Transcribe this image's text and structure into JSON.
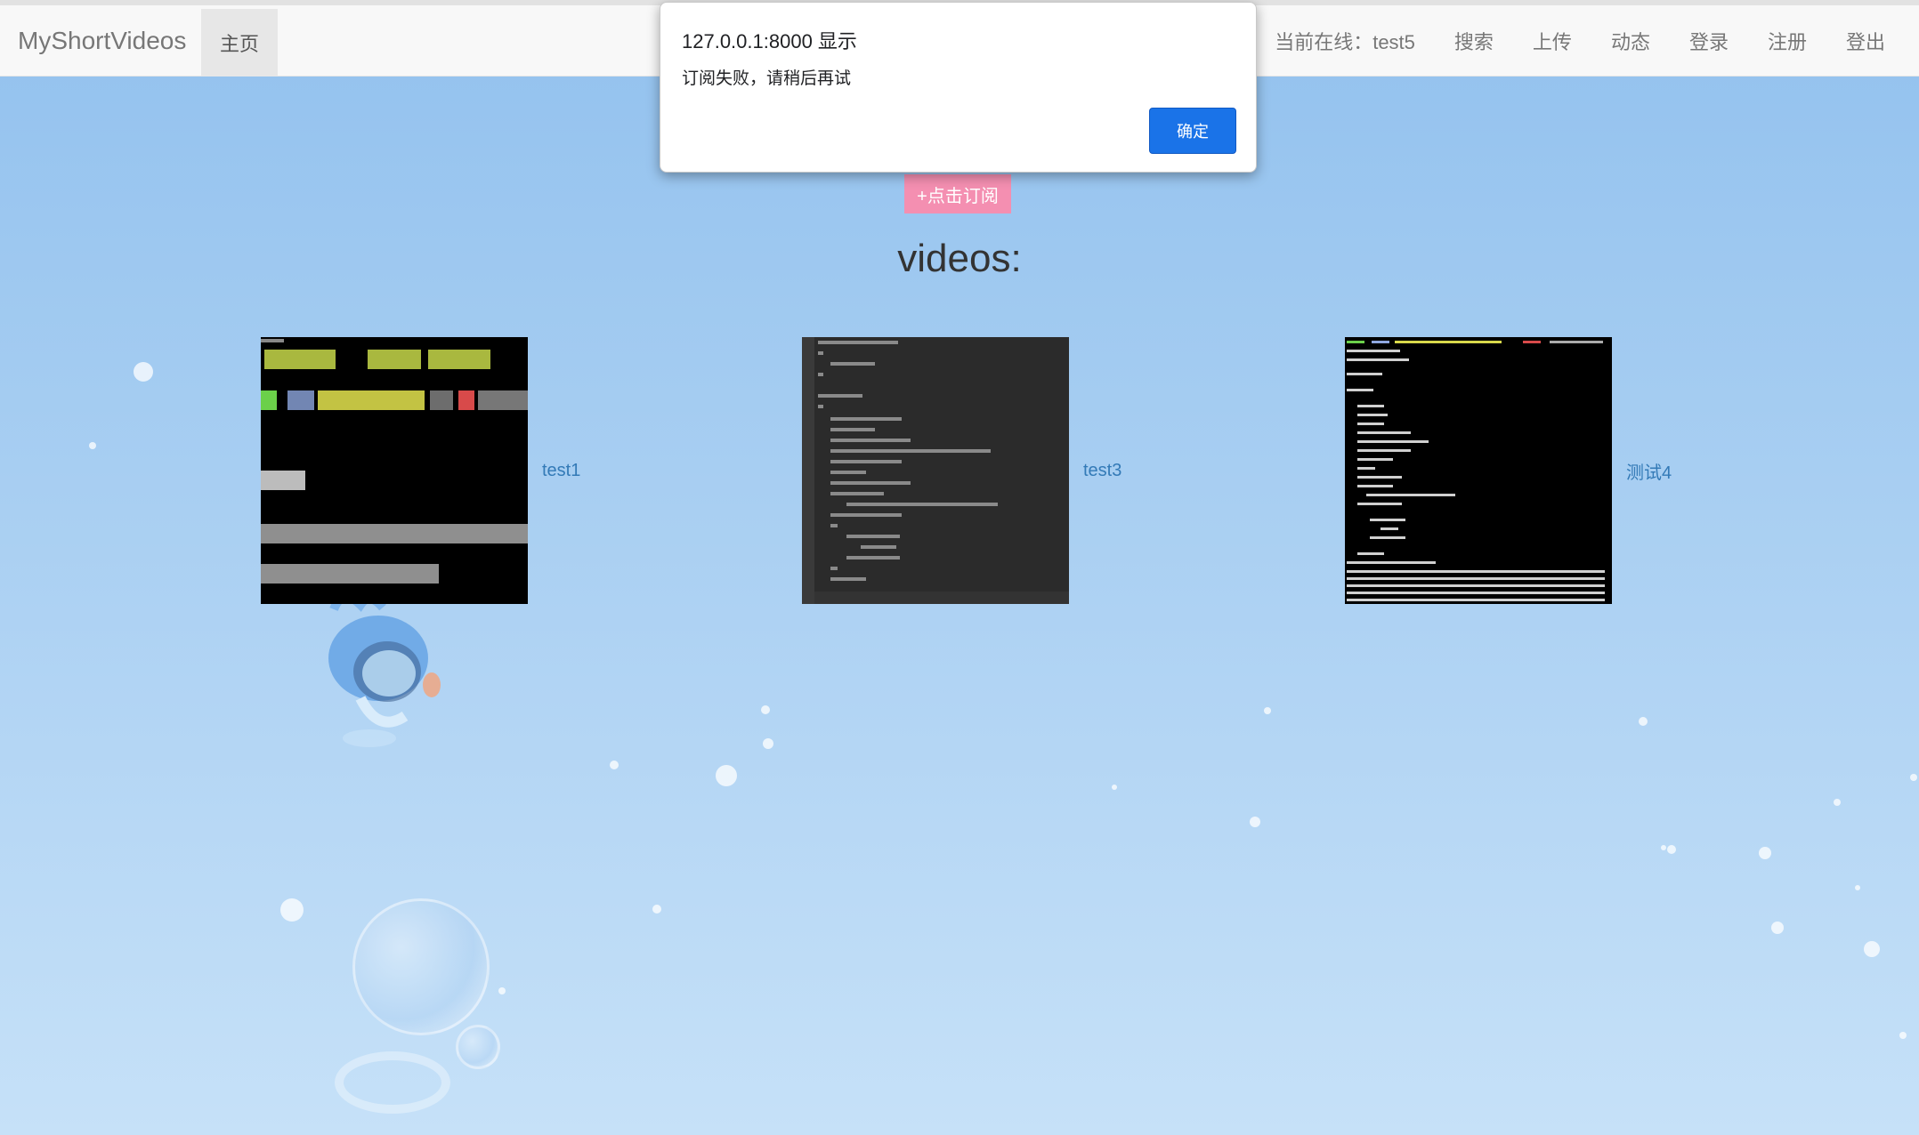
{
  "navbar": {
    "brand": "MyShortVideos",
    "home": "主页",
    "online": "当前在线：test5",
    "items": [
      "搜索",
      "上传",
      "动态",
      "登录",
      "注册",
      "登出"
    ]
  },
  "subscribe_label": "+点击订阅",
  "videos_heading": "videos:",
  "videos": [
    {
      "title": "test1"
    },
    {
      "title": "test3"
    },
    {
      "title": "测试4"
    }
  ],
  "dialog": {
    "title": "127.0.0.1:8000 显示",
    "message": "订阅失败，请稍后再试",
    "ok_label": "确定"
  },
  "colors": {
    "subscribe_bg": "#f48fb1",
    "link": "#337ab7",
    "dialog_button": "#1a73e8"
  }
}
